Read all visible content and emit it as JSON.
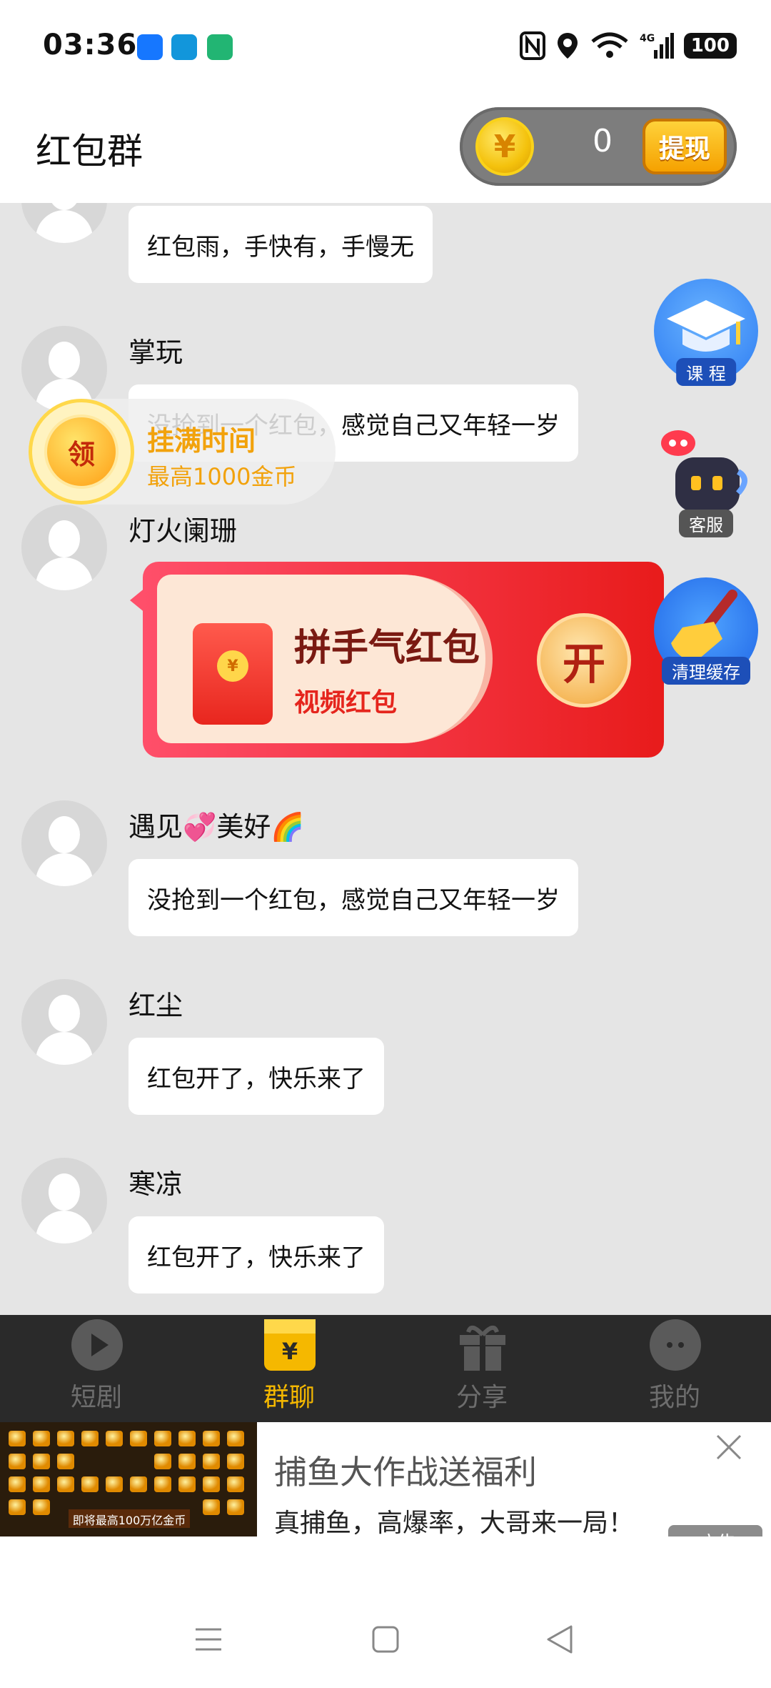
{
  "status_bar": {
    "time": "03:36",
    "battery": "100",
    "network": "4G"
  },
  "header": {
    "title": "红包群",
    "coins": "0",
    "coin_symbol": "¥",
    "withdraw_label": "提现"
  },
  "messages": [
    {
      "user": "",
      "text": "红包雨，手快有，手慢无"
    },
    {
      "user": "掌玩",
      "text": "没抢到一个红包，感觉自己又年轻一岁"
    },
    {
      "user": "灯火阑珊",
      "text": ""
    },
    {
      "user": "遇见💞美好🌈",
      "text": "没抢到一个红包，感觉自己又年轻一岁"
    },
    {
      "user": "红尘",
      "text": "红包开了，快乐来了"
    },
    {
      "user": "寒凉",
      "text": "红包开了，快乐来了"
    }
  ],
  "red_packet": {
    "title": "拼手气红包",
    "subtitle": "视频红包",
    "open_label": "开",
    "seal": "¥"
  },
  "floating_collect": {
    "button_label": "领",
    "title": "挂满时间",
    "subtitle": "最高1000金币"
  },
  "side_widgets": {
    "course": "课 程",
    "service": "客服",
    "clean": "清理缓存"
  },
  "bottom_nav": [
    {
      "label": "短剧",
      "active": false
    },
    {
      "label": "群聊",
      "active": true
    },
    {
      "label": "分享",
      "active": false
    },
    {
      "label": "我的",
      "active": false
    }
  ],
  "ad": {
    "title": "捕鱼大作战送福利",
    "description": "真捕鱼，高爆率，大哥来一局！",
    "badge": "广告",
    "thumb_caption": "即将最高100万亿金币"
  },
  "colors": {
    "accent": "#f5b800",
    "nav_bg": "#2a2a2a",
    "chat_bg": "#e5e5e5",
    "packet_red": "#e81b1b"
  }
}
